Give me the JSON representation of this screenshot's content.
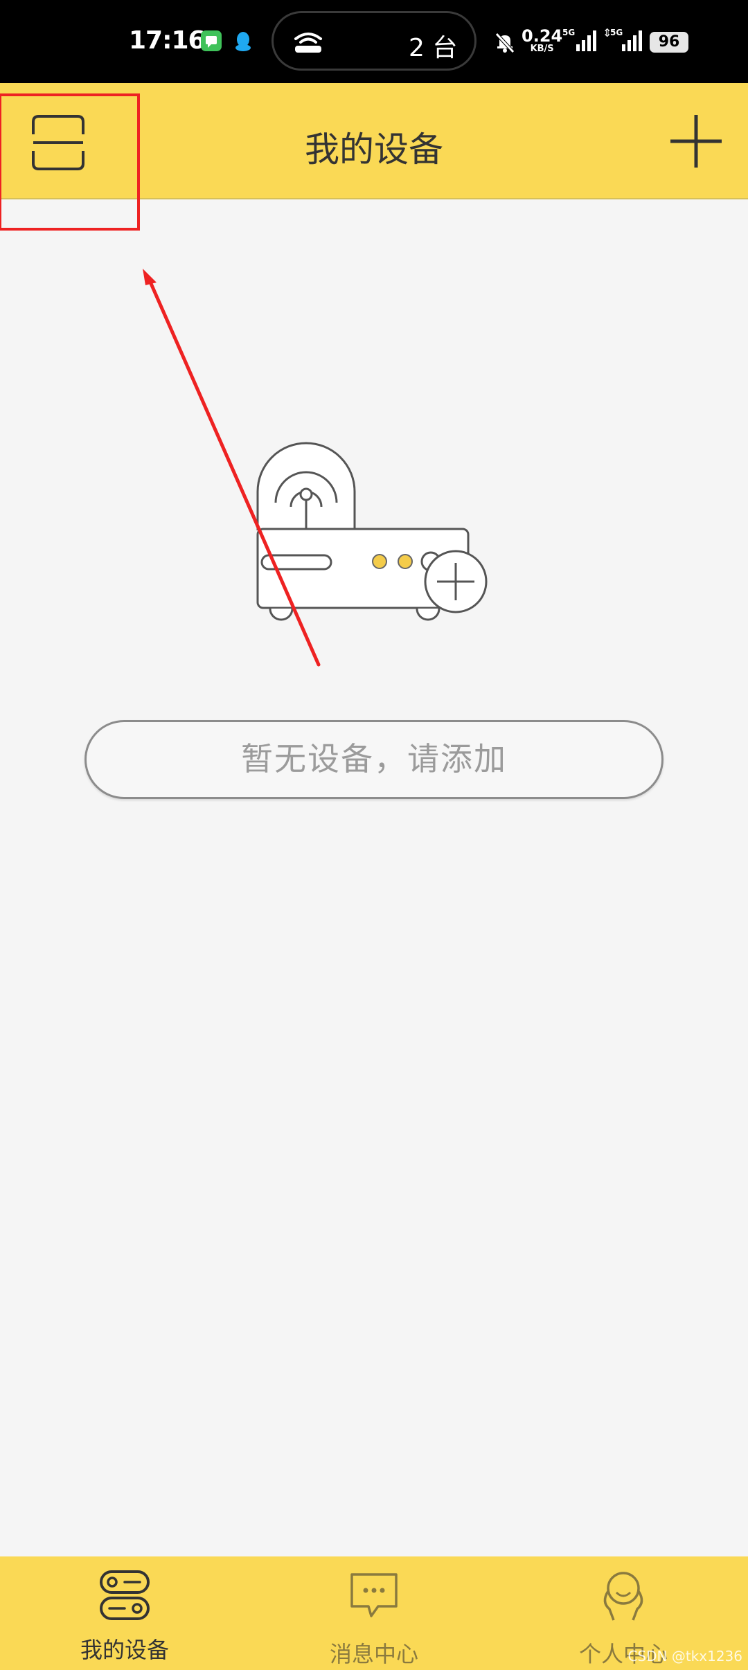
{
  "status_bar": {
    "time": "17:16",
    "island_text": "2 台",
    "net_speed": "0.24",
    "net_speed_unit": "KB/S",
    "signal_label_1": "5G",
    "signal_label_2": "5G",
    "battery": "96",
    "icons": [
      "message-app-icon",
      "qq-app-icon",
      "router-icon",
      "mute-bell-icon",
      "signal-icon",
      "battery-icon"
    ]
  },
  "app_bar": {
    "title": "我的设备",
    "left_icon": "scan-icon",
    "right_icon": "plus-icon"
  },
  "empty_state": {
    "button_label": "暂无设备，请添加",
    "illustration": "router-add-illustration"
  },
  "bottom_nav": {
    "items": [
      {
        "label": "我的设备",
        "icon": "devices-icon",
        "active": true
      },
      {
        "label": "消息中心",
        "icon": "message-icon",
        "active": false
      },
      {
        "label": "个人中心",
        "icon": "profile-icon",
        "active": false
      }
    ]
  },
  "watermark": "CSDN @tkx1236",
  "colors": {
    "accent_yellow": "#fad955",
    "background": "#f5f5f5",
    "title_text": "#333333",
    "annotation_red": "#ee2222"
  }
}
